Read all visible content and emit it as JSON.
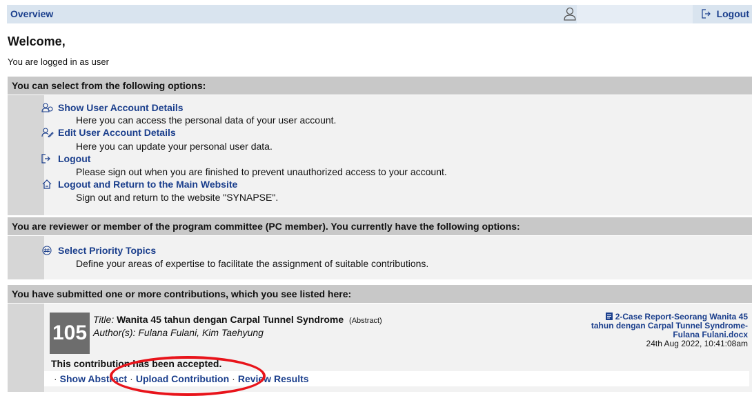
{
  "topbar": {
    "overview": "Overview",
    "logout": "Logout"
  },
  "welcome": "Welcome,",
  "logged_in": "You are logged in as user",
  "section1": {
    "heading": "You can select from the following options:",
    "options": [
      {
        "label": "Show User Account Details",
        "desc": "Here you can access the personal data of your user account."
      },
      {
        "label": "Edit User Account Details",
        "desc": "Here you can update your personal user data."
      },
      {
        "label": "Logout",
        "desc": "Please sign out when you are finished to prevent unauthorized access to your account."
      },
      {
        "label": "Logout and Return to the Main Website",
        "desc": "Sign out and return to the website \"SYNAPSE\"."
      }
    ]
  },
  "section2": {
    "heading": "You are reviewer or member of the program committee (PC member). You currently have the following options:",
    "options": [
      {
        "label": "Select Priority Topics",
        "desc": "Define your areas of expertise to facilitate the assignment of suitable contributions."
      }
    ]
  },
  "section3": {
    "heading": "You have submitted one or more contributions, which you see listed here:",
    "contribution": {
      "number": "105",
      "title_label": "Title:",
      "title": "Wanita 45 tahun dengan Carpal Tunnel Syndrome",
      "type": "(Abstract)",
      "authors_label": "Author(s):",
      "authors": "Fulana Fulani, Kim Taehyung",
      "file_name_lines": [
        "2-Case Report-Seorang Wanita 45",
        "tahun dengan Carpal Tunnel Syndrome-",
        "Fulana Fulani.docx"
      ],
      "file_date": "24th Aug 2022, 10:41:08am",
      "status": "This contribution has been accepted.",
      "actions": [
        "Show Abstract",
        "Upload Contribution",
        "Review Results"
      ]
    }
  },
  "colors": {
    "link": "#1a3e8c",
    "highlight_circle": "#e8141b"
  }
}
